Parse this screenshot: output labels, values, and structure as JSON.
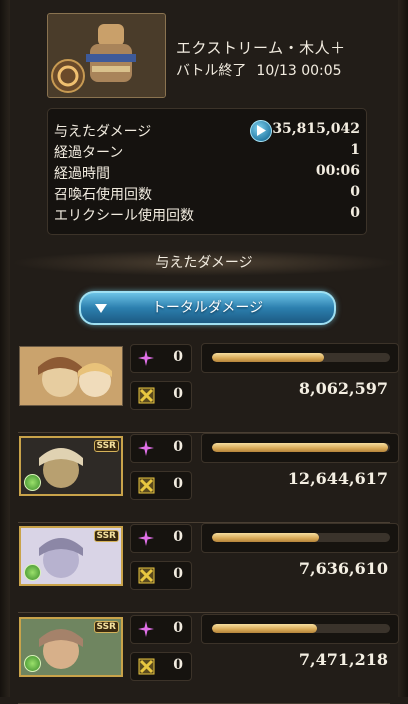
{
  "quest": {
    "title": "エクストリーム・木人＋",
    "status": "バトル終了",
    "datetime": "10/13 00:05"
  },
  "stats": {
    "damage_label": "与えたダメージ",
    "damage_value": "35,815,042",
    "turns_label": "経過ターン",
    "turns_value": "1",
    "time_label": "経過時間",
    "time_value": "00:06",
    "summon_label": "召喚石使用回数",
    "summon_value": "0",
    "elixir_label": "エリクシール使用回数",
    "elixir_value": "0"
  },
  "section_title": "与えたダメージ",
  "damage_type_button": "トータルダメージ",
  "characters": [
    {
      "ssr": false,
      "element": "none",
      "skill_count": "0",
      "ca_count": "0",
      "bar_fraction": 0.63,
      "damage": "8,062,597"
    },
    {
      "ssr": true,
      "ssr_label": "SSR",
      "element": "wind",
      "skill_count": "0",
      "ca_count": "0",
      "bar_fraction": 0.99,
      "damage": "12,644,617"
    },
    {
      "ssr": true,
      "ssr_label": "SSR",
      "element": "wind",
      "skill_count": "0",
      "ca_count": "0",
      "bar_fraction": 0.6,
      "damage": "7,636,610"
    },
    {
      "ssr": true,
      "ssr_label": "SSR",
      "element": "wind",
      "skill_count": "0",
      "ca_count": "0",
      "bar_fraction": 0.59,
      "damage": "7,471,218"
    }
  ],
  "colors": {
    "bar_gold": "#d8a957",
    "button_blue": "#2c7fae",
    "skill_icon": "#e070e8",
    "ca_icon": "#e8c640"
  }
}
